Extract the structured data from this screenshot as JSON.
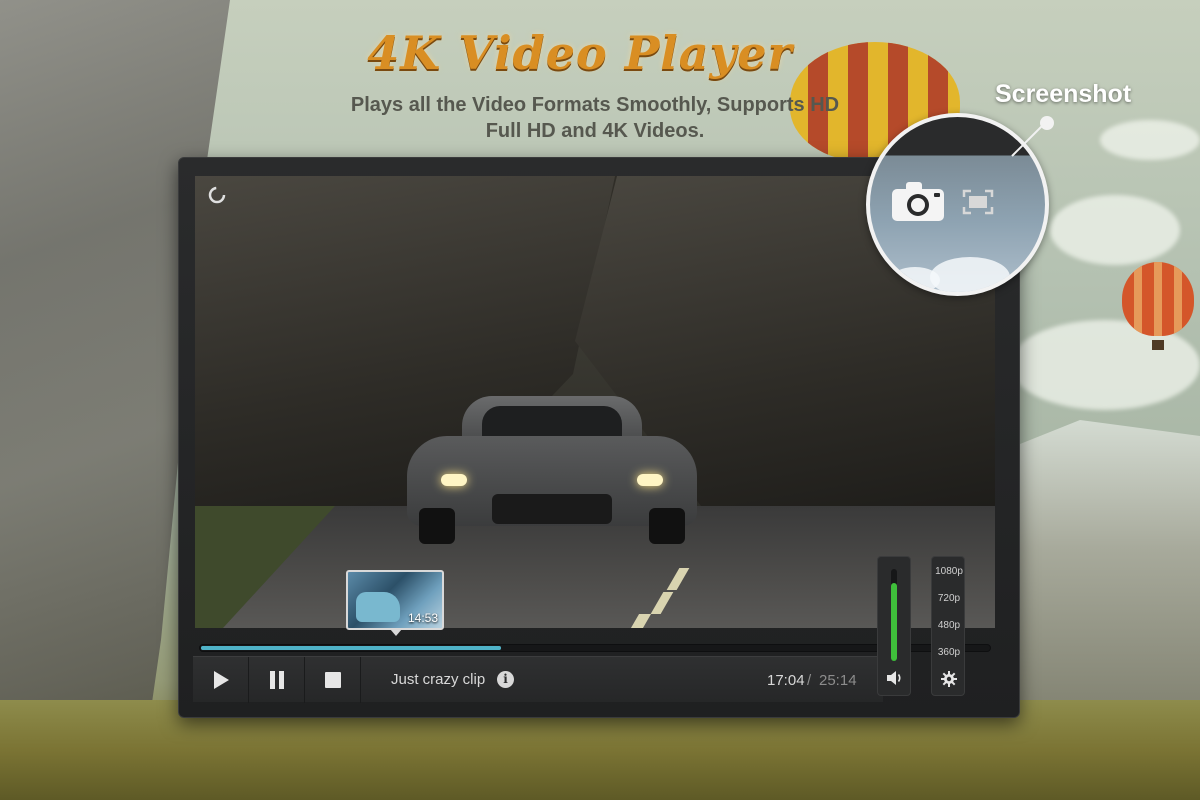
{
  "header": {
    "title": "4K Video Player",
    "subtitle_line1": "Plays all the Video Formats Smoothly, Supports HD",
    "subtitle_line2": "Full HD and 4K Videos."
  },
  "callout": {
    "label": "Screenshot"
  },
  "player": {
    "clip_title": "Just crazy clip",
    "time_current": "17:04",
    "time_separator": "/",
    "time_total": "25:14",
    "preview_time": "14:53",
    "progress_fraction": 0.38,
    "buffer_fraction": 0.38,
    "volume_fraction": 0.85,
    "quality_options": [
      "1080p",
      "720p",
      "480p",
      "360p"
    ]
  },
  "icons": {
    "play": "play-icon",
    "pause": "pause-icon",
    "stop": "stop-icon",
    "info": "info-icon",
    "volume": "volume-icon",
    "settings": "gear-icon",
    "screenshot": "camera-icon",
    "fullscreen": "fullscreen-icon",
    "loading": "loading-icon"
  },
  "colors": {
    "progress": "#4fb3c8",
    "volume": "#3fbf3b",
    "title": "#d98e23"
  }
}
